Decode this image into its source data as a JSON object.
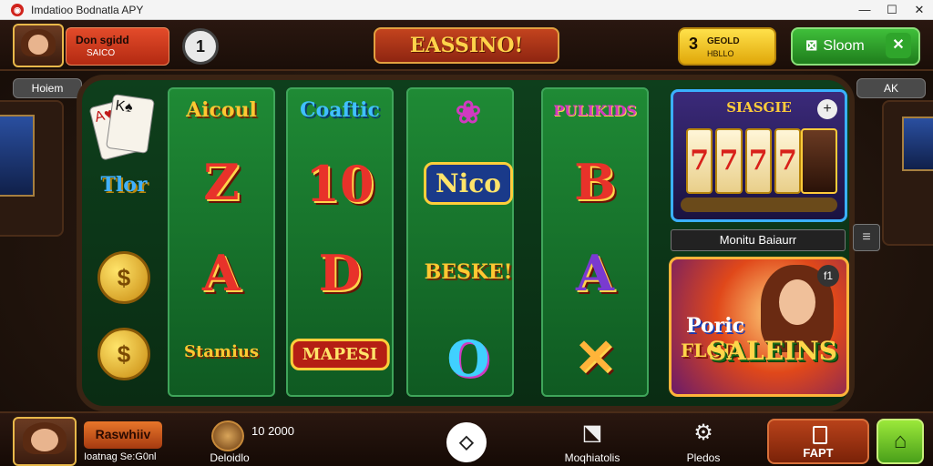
{
  "window": {
    "title": "Imdatioo Bodnatla APY",
    "controls": {
      "minimize": "—",
      "maximize": "☐",
      "close": "✕"
    }
  },
  "header": {
    "player": {
      "name": "Don sgidd",
      "subtitle": "SAICO"
    },
    "round_button": "1",
    "logo": "EASSINO!",
    "coins": {
      "count": "3",
      "label1": "GEOLD",
      "label2": "HBLLO"
    },
    "green_button": {
      "icon": "⊠",
      "label": "Sloom",
      "close": "✕"
    }
  },
  "side": {
    "left_pill": "Hoiem",
    "right_pill": "AK"
  },
  "reels": [
    {
      "cards": [
        "A♥",
        "K♠"
      ],
      "word": "Tlor",
      "coin1": "$",
      "coin2": "$"
    },
    {
      "word_top": "Aicoul",
      "letters": [
        "Z",
        "A"
      ],
      "word_bottom": "Stamius"
    },
    {
      "word_top": "Coaftic",
      "letters": [
        "10",
        "D"
      ],
      "badge": "MAPESI"
    },
    {
      "word_top": "",
      "badge_top": "Nico",
      "word_mid": "BESKE!",
      "letter": "O"
    },
    {
      "word_top": "PULIKIDS",
      "letters": [
        "B",
        "A"
      ],
      "cross": "✕"
    }
  ],
  "slot_panel": {
    "title": "SIASGIE",
    "plus": "+",
    "reels": [
      "7",
      "7",
      "7",
      "7"
    ]
  },
  "menu_bar": {
    "label": "Monitu Baiaurr",
    "side_icon": "≡"
  },
  "promo": {
    "line1": "Poric",
    "line2": "FLOD",
    "line3": "SALEINS",
    "badge": "f1"
  },
  "footer": {
    "name_button": "Raswhiiv",
    "subtitle": "Ioatnag Se:G0nl",
    "small_label": "Deloidlo",
    "credit": "10 2000",
    "center_icon": "◇",
    "icon1_label": "Moqhiatolis",
    "icon2_label": "Pledos",
    "red_button_label": "FAPT",
    "lock_icon": "🔒"
  },
  "colors": {
    "felt": "#0e3f1c",
    "reel": "#1f8a35",
    "accent_gold": "#ffc832",
    "accent_red": "#e8322a",
    "promo_border": "#ffb43a",
    "slot_border": "#3ab0ff"
  }
}
